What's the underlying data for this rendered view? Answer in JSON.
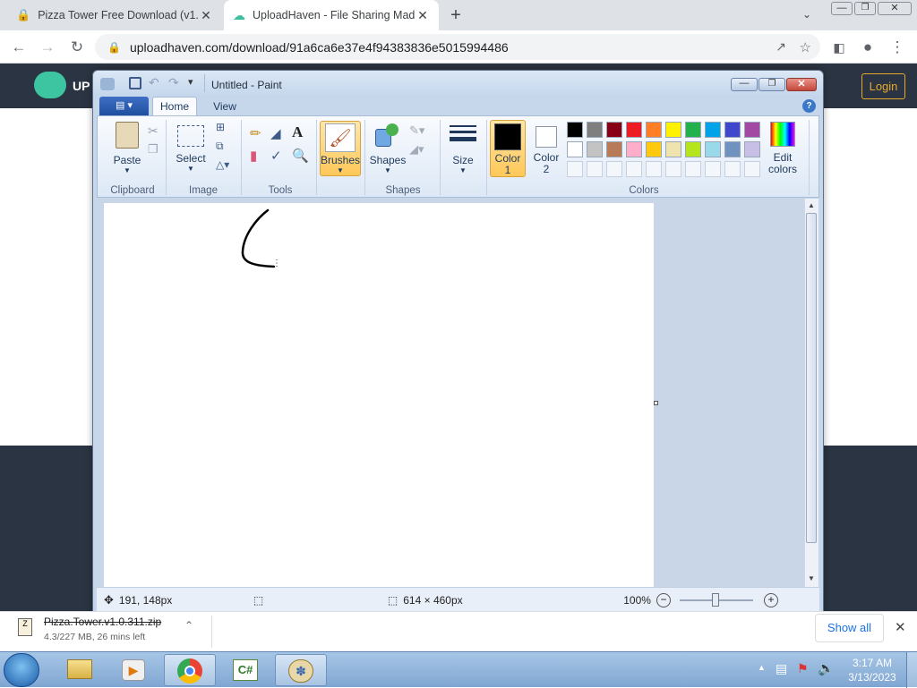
{
  "browser": {
    "tabs": [
      {
        "title": "Pizza Tower Free Download (v1.0",
        "active": false
      },
      {
        "title": "UploadHaven - File Sharing Mad",
        "active": true
      }
    ],
    "url": "uploadhaven.com/download/91a6ca6e37e4f94383836e5015994486",
    "new_tab": "+",
    "site_logo_text": "UP",
    "login_label": "Login"
  },
  "paint": {
    "title": "Untitled - Paint",
    "tabs": [
      "Home",
      "View"
    ],
    "groups": {
      "clipboard": "Clipboard",
      "image": "Image",
      "tools": "Tools",
      "shapes": "Shapes",
      "colors": "Colors"
    },
    "buttons": {
      "paste": "Paste",
      "select": "Select",
      "brushes": "Brushes",
      "shapes": "Shapes",
      "size": "Size",
      "color1_a": "Color",
      "color1_b": "1",
      "color2_a": "Color",
      "color2_b": "2",
      "edit_a": "Edit",
      "edit_b": "colors"
    },
    "palette_row1": [
      "#000000",
      "#7f7f7f",
      "#880015",
      "#ed1c24",
      "#ff7f27",
      "#fff200",
      "#22b14c",
      "#00a2e8",
      "#3f48cc",
      "#a349a4"
    ],
    "palette_row2": [
      "#ffffff",
      "#c3c3c3",
      "#b97a57",
      "#ffaec9",
      "#ffc90e",
      "#efe4b0",
      "#b5e61d",
      "#99d9ea",
      "#7092be",
      "#c8bfe7"
    ],
    "color1": "#000000",
    "color2": "#ffffff",
    "status": {
      "cursor_pos": "191, 148px",
      "canvas_size": "614 × 460px",
      "zoom": "100%"
    }
  },
  "downloads": {
    "file_name": "Pizza.Tower.v1.0.311.zip",
    "progress": "4.3/227 MB, 26 mins left",
    "show_all": "Show all"
  },
  "taskbar": {
    "time": "3:17 AM",
    "date": "3/13/2023"
  }
}
